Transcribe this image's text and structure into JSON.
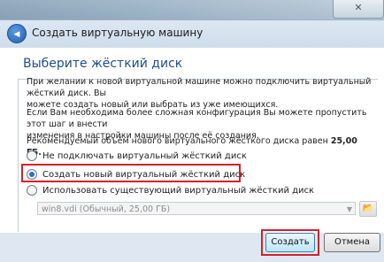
{
  "background": {
    "close_glyph": "✕"
  },
  "dialog": {
    "title": "Создать виртуальную машину",
    "back_glyph": "◀"
  },
  "panel": {
    "heading": "Выберите жёсткий диск",
    "paragraph1_line1": "При желании к новой виртуальной машине можно подключить виртуальный жёсткий диск. Вы",
    "paragraph1_line2": "можете создать новый или выбрать из уже имеющихся.",
    "paragraph2_line1": "Если Вам необходима более сложная конфигурация Вы можете пропустить этот шаг и внести",
    "paragraph2_line2": "изменения в настройки машины после её создания.",
    "recommended_prefix": "Рекомендуемый объём нового виртуального жёсткого диска равен ",
    "recommended_value": "25,00 ГБ.",
    "options": [
      {
        "label": "Не подключать виртуальный жёсткий диск",
        "checked": false
      },
      {
        "label": "Создать новый виртуальный жёсткий диск",
        "checked": true
      },
      {
        "label": "Использовать существующий виртуальный жёсткий диск",
        "checked": false
      }
    ],
    "existing_disk_value": "win8.vdi (Обычный, 25,00 ГБ)",
    "dropdown_arrow": "▼",
    "folder_icon_glyph": "📂"
  },
  "buttons": {
    "create": "Создать",
    "cancel": "Отмена"
  },
  "colors": {
    "heading": "#1e4f8c",
    "highlight": "#d62028",
    "accent": "#2f6fbf"
  }
}
